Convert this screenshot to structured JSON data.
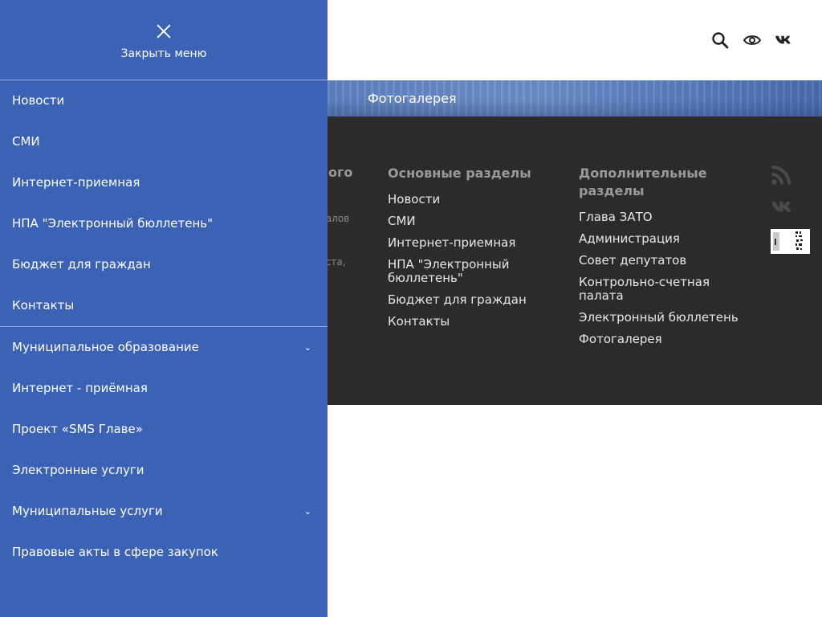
{
  "drawer": {
    "close_label": "Закрыть меню",
    "primary_items": [
      {
        "label": "Новости"
      },
      {
        "label": "СМИ"
      },
      {
        "label": "Интернет-приемная"
      },
      {
        "label": "НПА \"Электронный бюллетень\""
      },
      {
        "label": "Бюджет для граждан"
      },
      {
        "label": "Контакты"
      }
    ],
    "secondary_items": [
      {
        "label": "Муниципальное образование",
        "has_submenu": true
      },
      {
        "label": "Интернет - приёмная",
        "has_submenu": false
      },
      {
        "label": "Проект «SMS Главе»",
        "has_submenu": false
      },
      {
        "label": "Электронные услуги",
        "has_submenu": false
      },
      {
        "label": "Муниципальные услуги",
        "has_submenu": true
      },
      {
        "label": "Правовые акты в сфере закупок",
        "has_submenu": false
      }
    ],
    "chevron": "⌄"
  },
  "header": {
    "icons": [
      "search-icon",
      "eye-icon",
      "vk-icon"
    ]
  },
  "banner": {
    "title": "Фотогалерея"
  },
  "footer": {
    "partial_col": {
      "heading_fragment": "ного",
      "text_fragment_1": "иалов",
      "text_fragment_2": "йста,"
    },
    "main_sections": {
      "heading": "Основные разделы",
      "links": [
        "Новости",
        "СМИ",
        "Интернет-приемная",
        "НПА \"Электронный бюллетень\"",
        "Бюджет для граждан",
        "Контакты"
      ]
    },
    "extra_sections": {
      "heading": "Дополнительные разделы",
      "links": [
        "Глава ЗАТО",
        "Администрация",
        "Совет депутатов",
        "Контрольно-счетная палата",
        "Электронный бюллетень",
        "Фотогалерея"
      ]
    },
    "social": [
      "rss-icon",
      "vk-icon",
      "qr-code-icon"
    ]
  },
  "colors": {
    "drawer_bg": "#3b62b4",
    "footer_bg": "#2b2b2b",
    "heading_gray": "#9a9a9a"
  }
}
